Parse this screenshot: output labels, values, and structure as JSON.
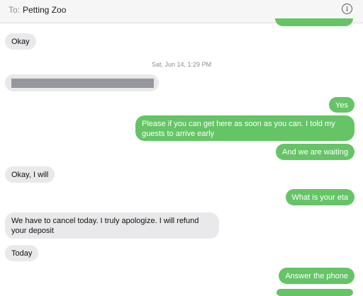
{
  "header": {
    "to_label": "To:",
    "recipient": "Petting Zoo",
    "info_icon": "info-circle-icon"
  },
  "timestamp": "Sat, Jun 14, 1:29 PM",
  "messages": [
    {
      "from": "them",
      "text": "Okay"
    },
    {
      "from": "them",
      "text": "",
      "redacted": true
    },
    {
      "from": "me",
      "text": "Yes"
    },
    {
      "from": "me",
      "text": "Please if you can get here as soon as you can. I told my guests to arrive early"
    },
    {
      "from": "me",
      "text": "And we are waiting"
    },
    {
      "from": "them",
      "text": "Okay, I will"
    },
    {
      "from": "me",
      "text": "What is your eta"
    },
    {
      "from": "them",
      "text": "We have to cancel today. I truly apologize. I will refund your deposit"
    },
    {
      "from": "them",
      "text": "Today"
    },
    {
      "from": "me",
      "text": "Answer the phone"
    }
  ],
  "colors": {
    "outgoing_bubble": "#65c466",
    "incoming_bubble": "#e9e9eb",
    "header_bg": "#f6f6f6"
  }
}
